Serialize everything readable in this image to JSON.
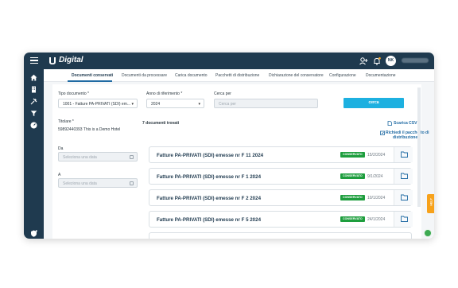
{
  "app": {
    "name": "Digital",
    "user_initials": "NK"
  },
  "tabs": [
    {
      "label": "Documenti conservati"
    },
    {
      "label": "Documenti da processare"
    },
    {
      "label": "Carica documento"
    },
    {
      "label": "Pacchetti di distribuzione"
    },
    {
      "label": "Dichiarazione del conservatore"
    },
    {
      "label": "Configurazione"
    },
    {
      "label": "Documentazione"
    }
  ],
  "filters": {
    "tipo_documento": {
      "label": "Tipo documento *",
      "value": "1001 - Fatture PA-PRIVATI (SDI) em..."
    },
    "anno": {
      "label": "Anno di riferimento *",
      "value": "2024"
    },
    "cerca_per": {
      "label": "Cerca per",
      "placeholder": "Cerca per"
    },
    "titolare": {
      "label": "Titolare *",
      "value": "59892440393 This is a Demo Hotel"
    },
    "da": {
      "label": "Da",
      "placeholder": "Seleziona una data"
    },
    "a": {
      "label": "A",
      "placeholder": "Seleziona una data"
    },
    "search_button": "cerca"
  },
  "results": {
    "count_label": "7 documenti trovati",
    "csv_link": "Scarica CSV",
    "package_link_1": "Richiedi il pacchetto di",
    "package_link_2": "distribuzione"
  },
  "documents": [
    {
      "title": "Fatture PA-PRIVATI (SDI) emesse nr F 11 2024",
      "status": "CONSERVATO",
      "date": "15/2/2024"
    },
    {
      "title": "Fatture PA-PRIVATI (SDI) emesse nr F 1 2024",
      "status": "CONSERVATO",
      "date": "9/1/2024"
    },
    {
      "title": "Fatture PA-PRIVATI (SDI) emesse nr F 2 2024",
      "status": "CONSERVATO",
      "date": "10/1/2024"
    },
    {
      "title": "Fatture PA-PRIVATI (SDI) emesse nr F 5 2024",
      "status": "CONSERVATO",
      "date": "24/1/2024"
    }
  ],
  "help_tab": "HELP",
  "colors": {
    "brand": "#1f3a4f",
    "accent": "#1db0e0",
    "status_ok": "#1e9e3e",
    "help": "#f7a21b"
  },
  "icons": {
    "sidebar": [
      "home-icon",
      "building-icon",
      "tools-icon",
      "filter-icon",
      "dashboard-icon",
      "shield-icon"
    ],
    "topbar": [
      "menu-icon",
      "add-user-icon",
      "bell-icon"
    ],
    "row": "folder-icon"
  }
}
